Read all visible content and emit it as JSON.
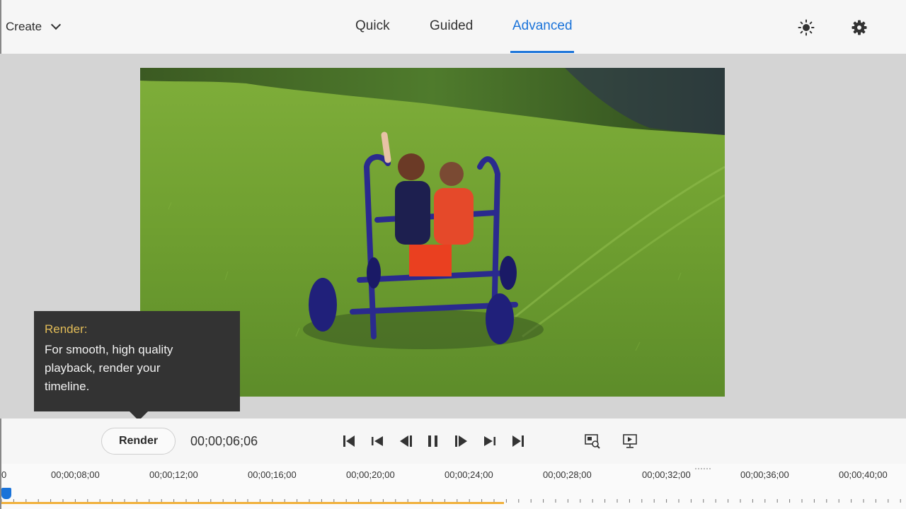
{
  "header": {
    "create_label": "Create",
    "tabs": [
      {
        "label": "Quick",
        "active": false
      },
      {
        "label": "Guided",
        "active": false
      },
      {
        "label": "Advanced",
        "active": true
      }
    ],
    "icons": [
      "brightness-icon",
      "settings-icon"
    ]
  },
  "tooltip": {
    "title": "Render:",
    "body": "For smooth, high quality playback, render your timeline."
  },
  "controls": {
    "render_label": "Render",
    "timecode": "00;00;06;06",
    "buttons": [
      "go-to-start-icon",
      "rewind-icon",
      "step-back-icon",
      "pause-icon",
      "step-forward-icon",
      "fast-forward-icon",
      "go-to-end-icon",
      "zoom-fit-icon",
      "fullscreen-preview-icon"
    ]
  },
  "timeline": {
    "first_label": "0",
    "labels": [
      "00;00;08;00",
      "00;00;12;00",
      "00;00;16;00",
      "00;00;20;00",
      "00;00;24;00",
      "00;00;28;00",
      "00;00;32;00",
      "00;00;36;00",
      "00;00;40;00"
    ],
    "rendered_fraction": 0.555
  },
  "colors": {
    "accent": "#1a73d9",
    "tooltip_title": "#e2bc58",
    "render_bar": "#f0b03a"
  }
}
